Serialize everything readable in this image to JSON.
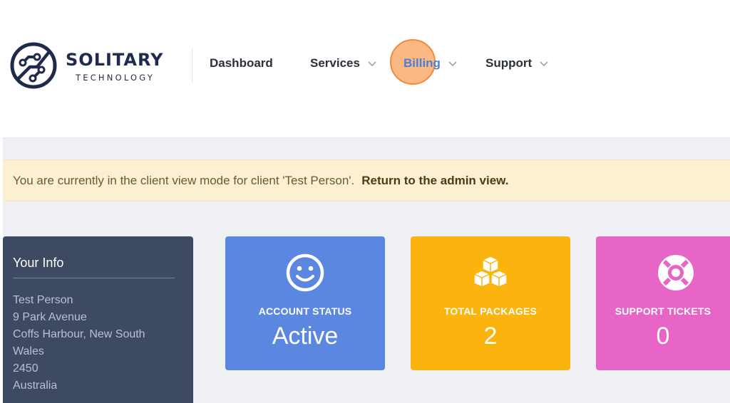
{
  "brand": {
    "name": "SOLITARY",
    "tagline": "TECHNOLOGY"
  },
  "nav": {
    "dashboard": "Dashboard",
    "services": "Services",
    "billing": "Billing",
    "support": "Support"
  },
  "notice": {
    "message": "You are currently in the client view mode for client 'Test Person'.",
    "link": "Return to the admin view."
  },
  "your_info": {
    "title": "Your Info",
    "lines": [
      "Test Person",
      "9 Park Avenue",
      "Coffs Harbour, New South",
      "Wales",
      "2450",
      "Australia"
    ]
  },
  "tiles": {
    "account_status": {
      "label": "ACCOUNT STATUS",
      "value": "Active",
      "icon": "smiley-icon",
      "color": "#5b87e0"
    },
    "total_packages": {
      "label": "TOTAL PACKAGES",
      "value": "2",
      "icon": "cubes-icon",
      "color": "#fbb40d"
    },
    "support_tickets": {
      "label": "SUPPORT TICKETS",
      "value": "0",
      "icon": "lifebuoy-icon",
      "color": "#e765c7"
    }
  },
  "colors": {
    "brand_navy": "#1f2a4d",
    "active_nav": "#4a7fd8",
    "notice_bg": "#fbf1d2",
    "info_panel": "#3e4a62"
  }
}
